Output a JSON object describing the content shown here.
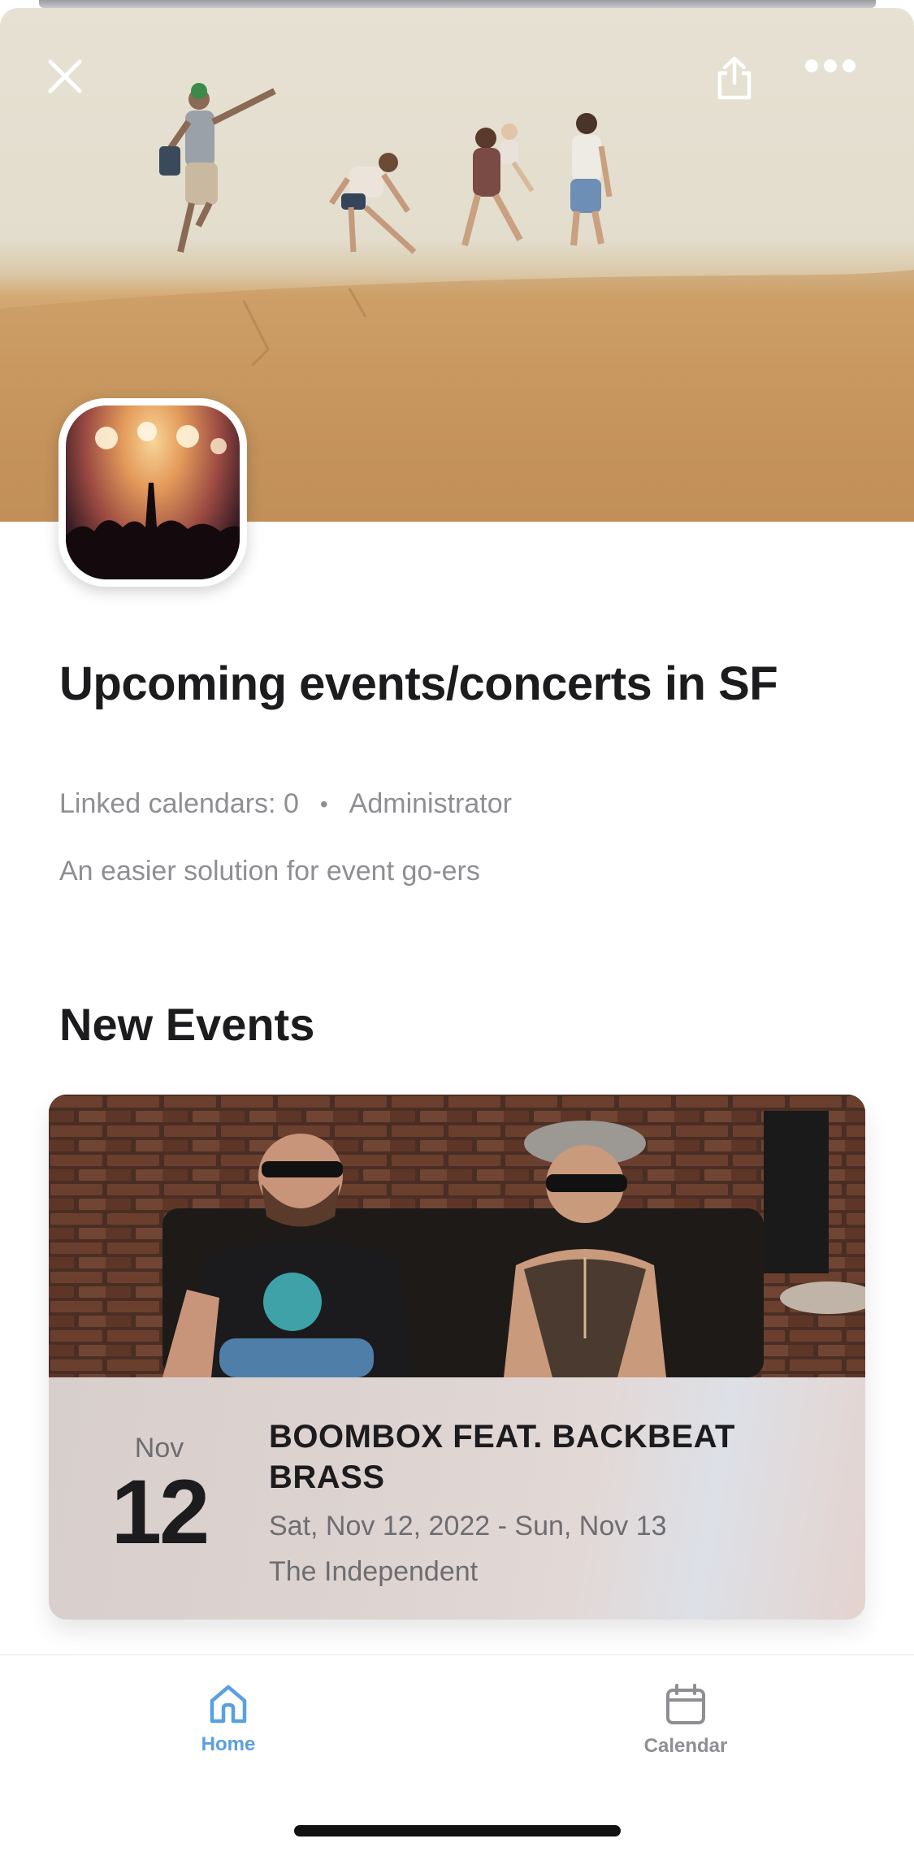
{
  "header": {
    "close_icon": "close-icon",
    "share_icon": "share-icon",
    "more_icon": "more-horizontal-icon"
  },
  "calendar": {
    "title": "Upcoming events/concerts in SF",
    "linked_calendars": "Linked calendars: 0",
    "separator": "•",
    "role": "Administrator",
    "description": "An easier solution for event go-ers"
  },
  "new_events": {
    "section_title": "New Events",
    "events": [
      {
        "month": "Nov",
        "day": "12",
        "name": "BOOMBOX FEAT. BACKBEAT BRASS",
        "date_range": "Sat, Nov 12, 2022 - Sun, Nov 13",
        "venue": "The Independent"
      }
    ]
  },
  "tab_bar": {
    "tabs": [
      {
        "label": "Home",
        "icon": "home-icon",
        "active": true
      },
      {
        "label": "Calendar",
        "icon": "calendar-icon",
        "active": false
      }
    ]
  },
  "colors": {
    "accent": "#5aa0e0",
    "text_primary": "#1c1c1e",
    "text_secondary": "#8e8e93"
  }
}
